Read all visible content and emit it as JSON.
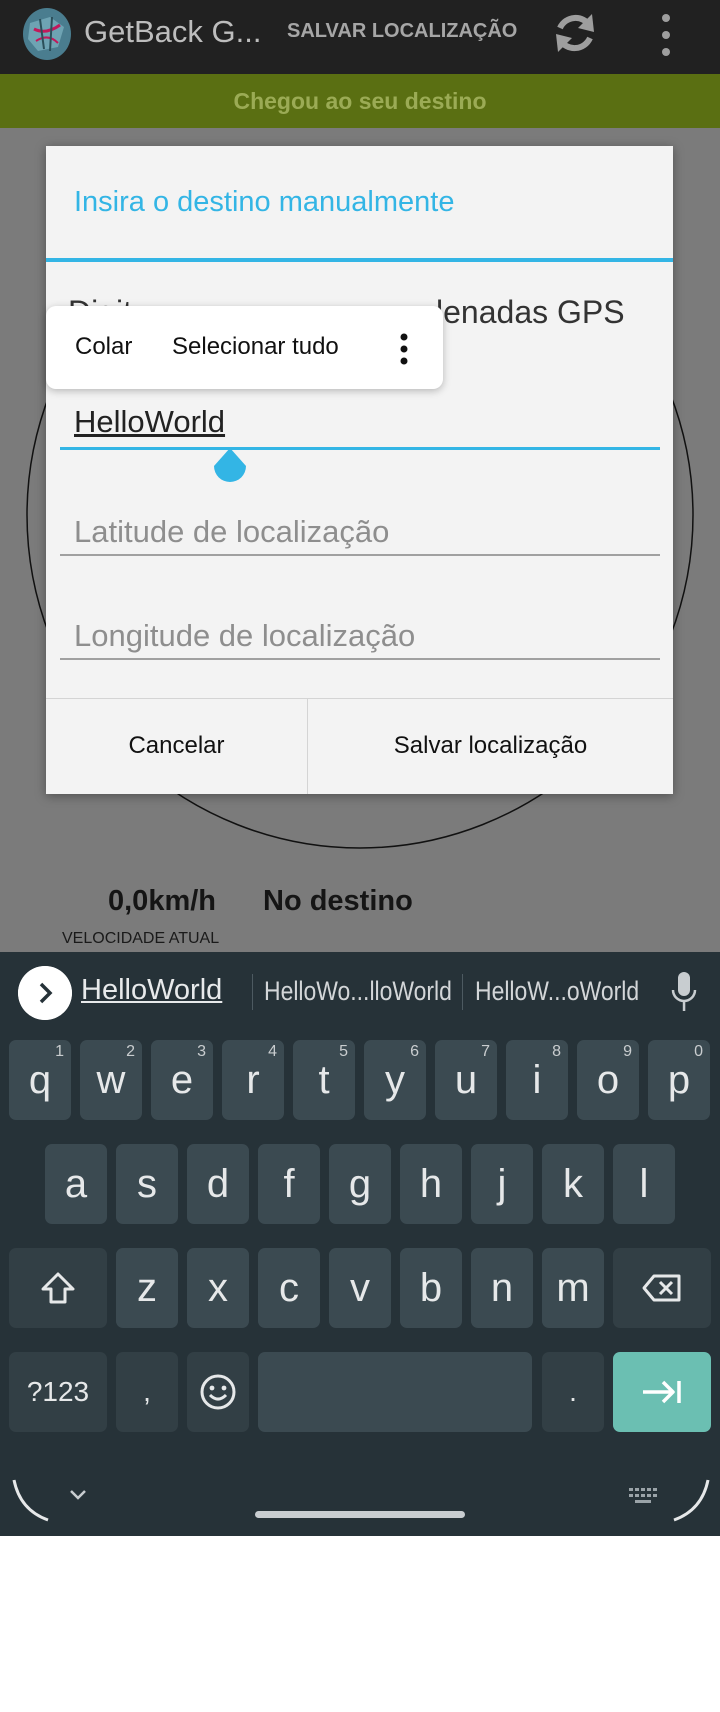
{
  "app_bar": {
    "title": "GetBack G...",
    "save_action": "SALVAR LOCALIZAÇÃO",
    "background": "#212121"
  },
  "banner": {
    "text": "Chegou ao seu destino",
    "color": "#5a6f12"
  },
  "background_screen": {
    "speed_value": "0,0km/h",
    "speed_label": "VELOCIDADE ATUAL",
    "status_value": "No destino"
  },
  "dialog": {
    "title": "Insira o destino manualmente",
    "message_visible_start": "Digit",
    "message_visible_end": "lenadas GPS",
    "name_field_value": "HelloWorld",
    "latitude_placeholder": "Latitude de localização",
    "longitude_placeholder": "Longitude de localização",
    "cancel_label": "Cancelar",
    "save_label": "Salvar localização",
    "accent_color": "#33b5e5"
  },
  "context_menu": {
    "paste_label": "Colar",
    "select_all_label": "Selecionar tudo"
  },
  "keyboard": {
    "suggestions": [
      "HelloWorld",
      "HelloWo...lloWorld",
      "HelloW...oWorld"
    ],
    "row1": [
      {
        "key": "q",
        "hint": "1"
      },
      {
        "key": "w",
        "hint": "2"
      },
      {
        "key": "e",
        "hint": "3"
      },
      {
        "key": "r",
        "hint": "4"
      },
      {
        "key": "t",
        "hint": "5"
      },
      {
        "key": "y",
        "hint": "6"
      },
      {
        "key": "u",
        "hint": "7"
      },
      {
        "key": "i",
        "hint": "8"
      },
      {
        "key": "o",
        "hint": "9"
      },
      {
        "key": "p",
        "hint": "0"
      }
    ],
    "row2": [
      "a",
      "s",
      "d",
      "f",
      "g",
      "h",
      "j",
      "k",
      "l"
    ],
    "row3": [
      "z",
      "x",
      "c",
      "v",
      "b",
      "n",
      "m"
    ],
    "symbols_label": "?123",
    "comma_label": ",",
    "period_label": ".",
    "enter_color": "#6bbfb2"
  }
}
